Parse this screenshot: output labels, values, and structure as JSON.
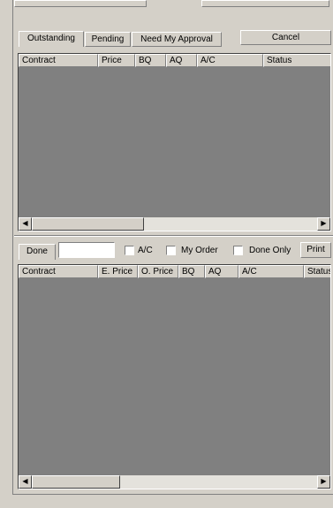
{
  "top_tabs": {
    "items": [
      {
        "label": "Outstanding",
        "active": true
      },
      {
        "label": "Pending",
        "active": false
      },
      {
        "label": "Need My Approval",
        "active": false
      }
    ]
  },
  "cancel_button": {
    "label": "Cancel"
  },
  "top_table": {
    "columns": [
      "Contract",
      "Price",
      "BQ",
      "AQ",
      "A/C",
      "Status"
    ]
  },
  "done_tab": {
    "label": "Done"
  },
  "filter": {
    "input_value": "",
    "ac_label": "A/C",
    "my_order_label": "My Order",
    "done_only_label": "Done Only",
    "print_label": "Print"
  },
  "bottom_table": {
    "columns": [
      "Contract",
      "E. Price",
      "O. Price",
      "BQ",
      "AQ",
      "A/C",
      "Status"
    ]
  },
  "icons": {
    "scroll_left": "arrow-left-icon",
    "scroll_right": "arrow-right-icon"
  }
}
